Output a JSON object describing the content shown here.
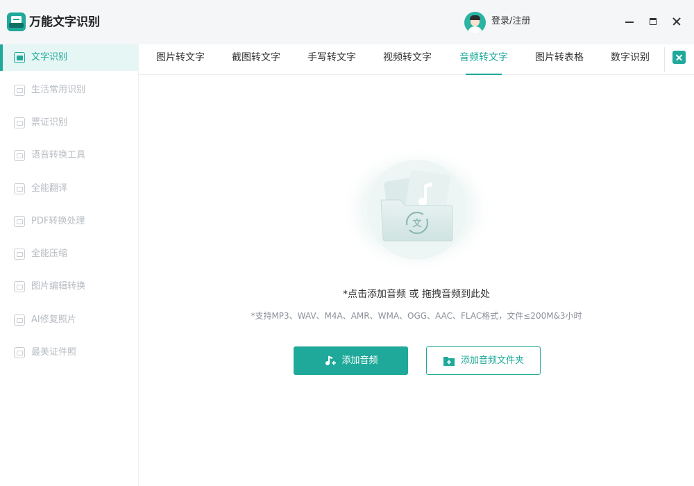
{
  "app": {
    "title": "万能文字识别"
  },
  "header": {
    "login_text": "登录/注册",
    "window_controls": {
      "minimize_icon": "minimize-icon",
      "maximize_icon": "maximize-icon",
      "close_icon": "close-icon"
    }
  },
  "sidebar": {
    "items": [
      {
        "label": "文字识别",
        "icon": "text-scan-icon",
        "active": true
      },
      {
        "label": "生活常用识别",
        "icon": "scan-frame-icon",
        "active": false
      },
      {
        "label": "票证识别",
        "icon": "ticket-scan-icon",
        "active": false
      },
      {
        "label": "语音转换工具",
        "icon": "voice-convert-icon",
        "active": false
      },
      {
        "label": "全能翻译",
        "icon": "translate-icon",
        "active": false
      },
      {
        "label": "PDF转换处理",
        "icon": "pdf-icon",
        "active": false
      },
      {
        "label": "全能压缩",
        "icon": "compress-icon",
        "active": false
      },
      {
        "label": "图片编辑转换",
        "icon": "image-edit-icon",
        "active": false
      },
      {
        "label": "AI修复照片",
        "icon": "ai-photo-icon",
        "active": false
      },
      {
        "label": "最美证件照",
        "icon": "id-photo-icon",
        "active": false
      }
    ]
  },
  "tabs": {
    "items": [
      {
        "label": "图片转文字",
        "active": false
      },
      {
        "label": "截图转文字",
        "active": false
      },
      {
        "label": "手写转文字",
        "active": false
      },
      {
        "label": "视频转文字",
        "active": false
      },
      {
        "label": "音频转文字",
        "active": true
      },
      {
        "label": "图片转表格",
        "active": false
      },
      {
        "label": "数字识别",
        "active": false
      }
    ]
  },
  "main": {
    "hint_primary": "*点击添加音频 或 拖拽音频到此处",
    "hint_secondary": "*支持MP3、WAV、M4A、AMR、WMA、OGG、AAC、FLAC格式，文件≤200M&3小时",
    "add_audio_label": "添加音频",
    "add_folder_label": "添加音频文件夹",
    "illustration_glyph": "文"
  },
  "colors": {
    "accent": "#1fa99a",
    "sidebar_inactive": "#b7bcc2",
    "header_bg": "#f4f6f8"
  }
}
